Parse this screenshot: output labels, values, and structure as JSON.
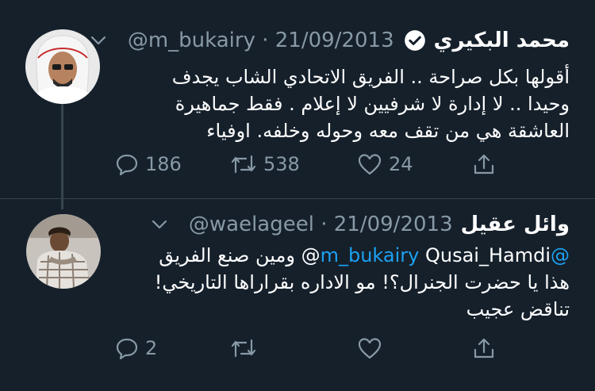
{
  "tweets": [
    {
      "name": "محمد البكيري",
      "verified": true,
      "handle": "@m_bukairy",
      "separator": " · ",
      "date": "21/09/2013",
      "text_lines": [
        "أقولها بكل صراحة .. الفريق الاتحادي الشاب يجدف",
        "وحيدا .. لا إدارة لا شرفيين لا إعلام . فقط جماهيرة",
        "العاشقة هي من تقف معه وحوله وخلفه. اوفياء"
      ],
      "replies": "186",
      "retweets": "538",
      "likes": "24"
    },
    {
      "name": "وائل عقيل",
      "verified": false,
      "handle": "@waelageel",
      "separator": " · ",
      "date": "21/09/2013",
      "mention": "@m_bukairy",
      "line1_rest": "Qusai_Hamdi@ ومين صنع الفريق",
      "text_lines": [
        "هذا يا حضرت الجنرال؟! مو الاداره بقراراها التاريخي!",
        "تناقض عجيب"
      ],
      "replies": "2",
      "retweets": "",
      "likes": ""
    }
  ],
  "colors": {
    "background": "#15202b",
    "secondary_text": "#8899a6",
    "link": "#1da1f2",
    "divider": "#38444d"
  },
  "icons": [
    "verified-badge-icon",
    "chevron-down-icon",
    "reply-icon",
    "retweet-icon",
    "like-icon",
    "share-icon"
  ]
}
